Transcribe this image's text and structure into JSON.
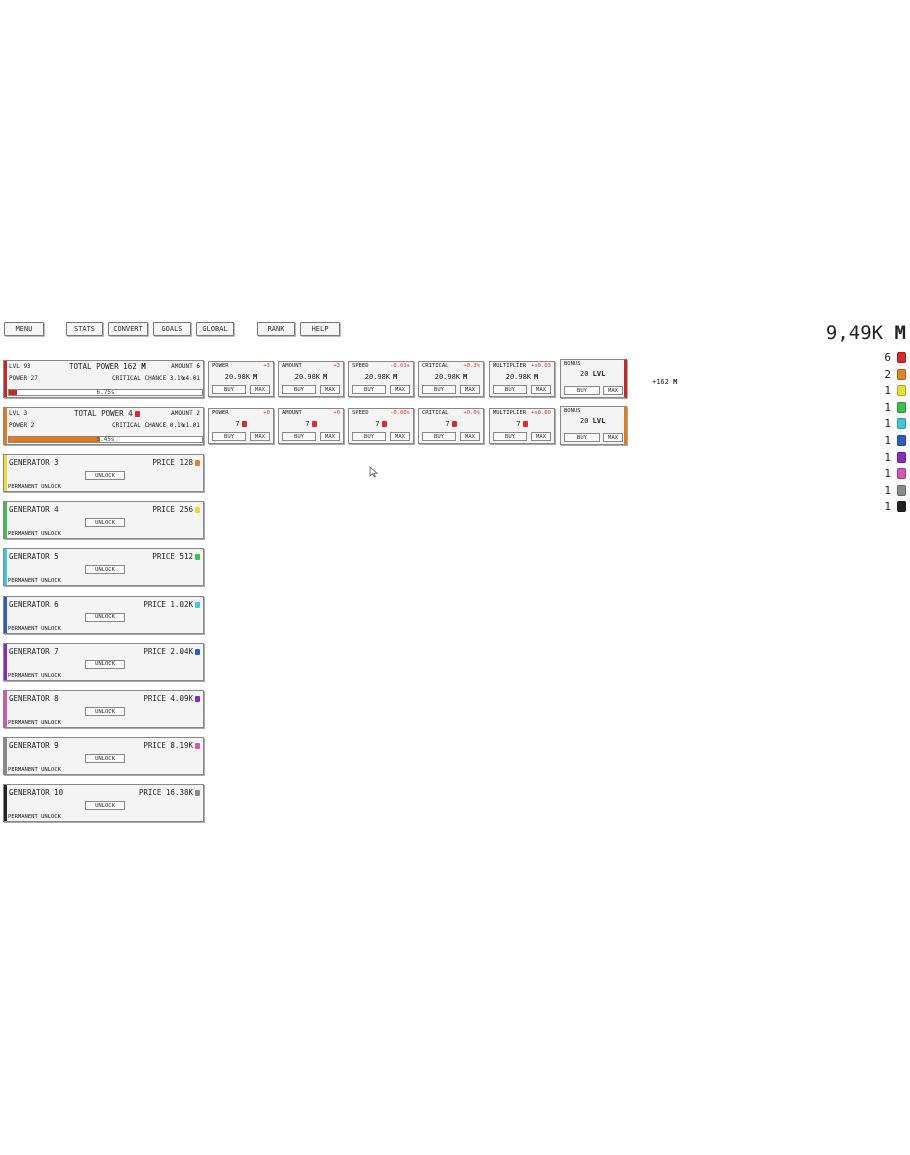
{
  "nav": {
    "menu": "MENU",
    "stats": "STATS",
    "convert": "CONVERT",
    "goals": "GOALS",
    "global": "GLOBAL",
    "rank": "RANK",
    "help": "HELP"
  },
  "currency": {
    "total": "9,49K",
    "total_unit": "M",
    "items": [
      {
        "count": "6",
        "color": "#d62b2b"
      },
      {
        "count": "2",
        "color": "#e0822a"
      },
      {
        "count": "1",
        "color": "#e8dc3a"
      },
      {
        "count": "1",
        "color": "#3cc24a"
      },
      {
        "count": "1",
        "color": "#45c6d8"
      },
      {
        "count": "1",
        "color": "#2c5fbf"
      },
      {
        "count": "1",
        "color": "#8a2dbf"
      },
      {
        "count": "1",
        "color": "#d457b0"
      },
      {
        "count": "1",
        "color": "#8a8a8a"
      },
      {
        "count": "1",
        "color": "#222222"
      }
    ]
  },
  "gen1": {
    "lvl": "LVL 93",
    "total_power": "TOTAL POWER 162",
    "total_power_unit": "M",
    "amount": "AMOUNT 6",
    "power": "POWER 27",
    "critical": "CRITICAL CHANCE 3.1%",
    "multiplier": "x4.01",
    "progress_label": "6.75s",
    "progress": 0.04,
    "color": "#c62828",
    "income": "+162",
    "income_unit": "M",
    "upgrades": [
      {
        "name": "POWER",
        "delta": "+3",
        "price": "20.98K",
        "unit": "M",
        "buy": "BUY",
        "max": "MAX"
      },
      {
        "name": "AMOUNT",
        "delta": "+3",
        "price": "20.98K",
        "unit": "M",
        "buy": "BUY",
        "max": "MAX"
      },
      {
        "name": "SPEED",
        "delta": "-0.03s",
        "price": "20.98K",
        "unit": "M",
        "buy": "BUY",
        "max": "MAX"
      },
      {
        "name": "CRITICAL",
        "delta": "+0.3%",
        "price": "20.98K",
        "unit": "M",
        "buy": "BUY",
        "max": "MAX"
      },
      {
        "name": "MULTIPLIER",
        "delta": "+x0.03",
        "price": "20.98K",
        "unit": "M",
        "buy": "BUY",
        "max": "MAX"
      }
    ],
    "bonus": {
      "name": "BONUS",
      "value": "20",
      "unit": "LVL",
      "buy": "BUY",
      "max": "MAX"
    }
  },
  "gen2": {
    "lvl": "LVL 3",
    "total_power": "TOTAL POWER 4",
    "amount": "AMOUNT 2",
    "power": "POWER 2",
    "critical": "CRITICAL CHANCE 0.1%",
    "multiplier": "x1.01",
    "progress_label": "5.45s",
    "progress": 0.47,
    "color": "#e07b22",
    "upgrades": [
      {
        "name": "POWER",
        "delta": "+0",
        "price": "7",
        "buy": "BUY",
        "max": "MAX"
      },
      {
        "name": "AMOUNT",
        "delta": "+0",
        "price": "7",
        "buy": "BUY",
        "max": "MAX"
      },
      {
        "name": "SPEED",
        "delta": "-0.00s",
        "price": "7",
        "buy": "BUY",
        "max": "MAX"
      },
      {
        "name": "CRITICAL",
        "delta": "+0.0%",
        "price": "7",
        "buy": "BUY",
        "max": "MAX"
      },
      {
        "name": "MULTIPLIER",
        "delta": "+x0.00",
        "price": "7",
        "buy": "BUY",
        "max": "MAX"
      }
    ],
    "bonus": {
      "name": "BONUS",
      "value": "20",
      "unit": "LVL",
      "buy": "BUY",
      "max": "MAX"
    }
  },
  "locked": [
    {
      "name": "GENERATOR 3",
      "price": "PRICE 128",
      "color": "#e0822a",
      "edge": "#e8dc3a",
      "unlock": "UNLOCK",
      "perm": "PERMANENT UNLOCK"
    },
    {
      "name": "GENERATOR 4",
      "price": "PRICE 256",
      "color": "#e8dc3a",
      "edge": "#3cc24a",
      "unlock": "UNLOCK",
      "perm": "PERMANENT UNLOCK"
    },
    {
      "name": "GENERATOR 5",
      "price": "PRICE 512",
      "color": "#3cc24a",
      "edge": "#45c6d8",
      "unlock": "UNLOCK",
      "perm": "PERMANENT UNLOCK"
    },
    {
      "name": "GENERATOR 6",
      "price": "PRICE 1.02K",
      "color": "#45c6d8",
      "edge": "#2c5fbf",
      "unlock": "UNLOCK",
      "perm": "PERMANENT UNLOCK"
    },
    {
      "name": "GENERATOR 7",
      "price": "PRICE 2.04K",
      "color": "#2c5fbf",
      "edge": "#8a2dbf",
      "unlock": "UNLOCK",
      "perm": "PERMANENT UNLOCK"
    },
    {
      "name": "GENERATOR 8",
      "price": "PRICE 4.09K",
      "color": "#8a2dbf",
      "edge": "#d457b0",
      "unlock": "UNLOCK",
      "perm": "PERMANENT UNLOCK"
    },
    {
      "name": "GENERATOR 9",
      "price": "PRICE 8.19K",
      "color": "#d457b0",
      "edge": "#8a8a8a",
      "unlock": "UNLOCK",
      "perm": "PERMANENT UNLOCK"
    },
    {
      "name": "GENERATOR 10",
      "price": "PRICE 16.38K",
      "color": "#8a8a8a",
      "edge": "#222222",
      "unlock": "UNLOCK",
      "perm": "PERMANENT UNLOCK"
    }
  ]
}
